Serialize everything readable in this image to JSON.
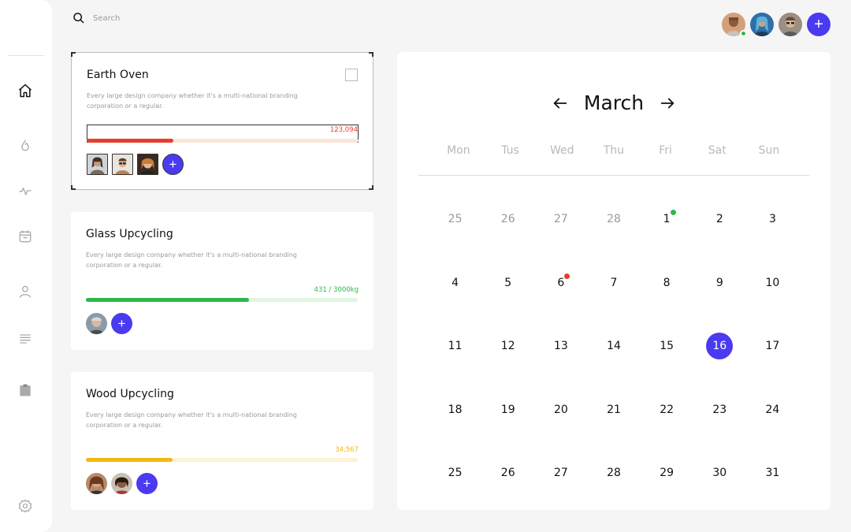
{
  "search": {
    "placeholder": "Search"
  },
  "header": {
    "avatars": [
      "avatar-user-1",
      "avatar-user-2",
      "avatar-user-3"
    ],
    "add_label": "+"
  },
  "sidebar": {
    "items": [
      "home-icon",
      "flame-icon",
      "activity-icon",
      "calendar-icon",
      "user-icon",
      "list-icon",
      "clipboard-icon"
    ],
    "footer": "settings-icon"
  },
  "cards": [
    {
      "title": "Earth Oven",
      "desc": "Every large design company whether it's a multi-national branding corporation or a regular.",
      "value": "123,094",
      "progress": 0.32,
      "color": "#e53e2f",
      "track": "#fbe6d8",
      "members": 3,
      "add_label": "+"
    },
    {
      "title": "Glass Upcycling",
      "desc": "Every large design company whether it's a multi-national branding corporation or a regular.",
      "value": "431 / 3000kg",
      "progress": 0.6,
      "color": "#2db84c",
      "track": "#e2f7e0",
      "members": 1,
      "add_label": "+"
    },
    {
      "title": "Wood Upcycling",
      "desc": "Every large design company whether it's a multi-national branding corporation or a regular.",
      "value": "34,567",
      "progress": 0.32,
      "color": "#f5b716",
      "track": "#fdf2d6",
      "members": 2,
      "add_label": "+"
    }
  ],
  "calendar": {
    "month": "March",
    "weekdays": [
      "Mon",
      "Tus",
      "Wed",
      "Thu",
      "Fri",
      "Sat",
      "Sun"
    ],
    "weeks": [
      [
        "25",
        "26",
        "27",
        "28",
        "1",
        "2",
        "3"
      ],
      [
        "4",
        "5",
        "6",
        "7",
        "8",
        "9",
        "10"
      ],
      [
        "11",
        "12",
        "13",
        "14",
        "15",
        "16",
        "17"
      ],
      [
        "18",
        "19",
        "20",
        "21",
        "22",
        "23",
        "24"
      ],
      [
        "25",
        "26",
        "27",
        "28",
        "29",
        "30",
        "31"
      ]
    ],
    "muted_first_week": 4,
    "selected": "16",
    "event_dots": [
      {
        "day": "1",
        "color": "#2db84c"
      },
      {
        "day": "6",
        "color": "#e53e2f"
      }
    ]
  },
  "colors": {
    "accent": "#4a3af0"
  }
}
